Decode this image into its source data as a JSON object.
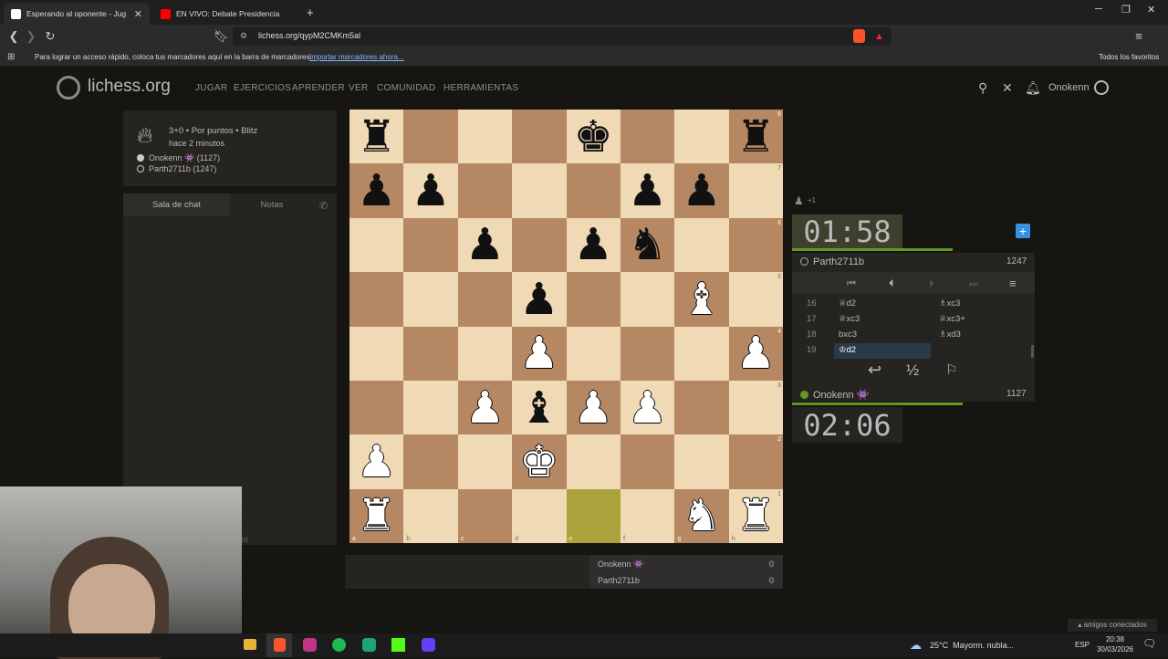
{
  "browser": {
    "tabs": [
      {
        "label": "Esperando al oponente - Jug",
        "favicon_color": "#ffffff"
      },
      {
        "label": "EN VIVO: Debate Presidencia",
        "favicon_color": "#ff0000"
      }
    ],
    "new_tab": "+",
    "url": "lichess.org/qypM2CMKm5al",
    "bookmarks_hint": "Para lograr un acceso rápido, coloca tus marcadores aquí en la barra de marcadores.",
    "bookmarks_import": "Importar marcadores ahora...",
    "all_favorites": "Todos los favoritos"
  },
  "site": {
    "logo": "lichess.org",
    "menu": [
      "JUGAR",
      "EJERCICIOS",
      "APRENDER",
      "VER",
      "COMUNIDAD",
      "HERRAMIENTAS"
    ],
    "username": "Onokenn"
  },
  "game_info": {
    "format": "3+0 • Por puntos • Blitz",
    "time_ago": "hace 2 minutos",
    "white_player": "Onokenn 👾 (1127)",
    "black_player": "Parth2711b (1247)"
  },
  "chat": {
    "tab_chat": "Sala de chat",
    "tab_notes": "Notas",
    "cutoff_text": "nt"
  },
  "board": {
    "files": [
      "a",
      "b",
      "c",
      "d",
      "e",
      "f",
      "g",
      "h"
    ],
    "ranks": [
      "8",
      "7",
      "6",
      "5",
      "4",
      "3",
      "2",
      "1"
    ],
    "highlight": [
      "e1"
    ],
    "pieces": {
      "a8": "bR",
      "e8": "bK",
      "h8": "bR",
      "a7": "bP",
      "b7": "bP",
      "f7": "bP",
      "g7": "bP",
      "c6": "bP",
      "e6": "bP",
      "f6": "bN",
      "d5": "bP",
      "g5": "wB",
      "d4": "wP",
      "h4": "wP",
      "c3": "wP",
      "d3": "bB",
      "e3": "wP",
      "f3": "wP",
      "a2": "wP",
      "d2": "wK",
      "a1": "wR",
      "g1": "wN",
      "h1": "wR"
    }
  },
  "score": {
    "player1": "Onokenn 👾",
    "player1_score": "0",
    "player2": "Parth2711b",
    "player2_score": "0"
  },
  "right_panel": {
    "material_diff": "+1",
    "clock_top": "01:58",
    "clock_bottom": "02:06",
    "opponent_name": "Parth2711b",
    "opponent_rating": "1247",
    "self_name": "Onokenn 👾",
    "self_rating": "1127",
    "moves": [
      {
        "num": "16",
        "white": "♕d2",
        "black": "♗xc3"
      },
      {
        "num": "17",
        "white": "♕xc3",
        "black": "♕xc3+"
      },
      {
        "num": "18",
        "white": "bxc3",
        "black": "♗xd3"
      },
      {
        "num": "19",
        "white": "♔d2",
        "black": ""
      }
    ],
    "draw_label": "½"
  },
  "system": {
    "weather": "25°C  Mayorm. nubla...",
    "lang": "ESP",
    "time": "20:38",
    "date": "30/03/2026",
    "friends": "▴ amigos conectados"
  }
}
